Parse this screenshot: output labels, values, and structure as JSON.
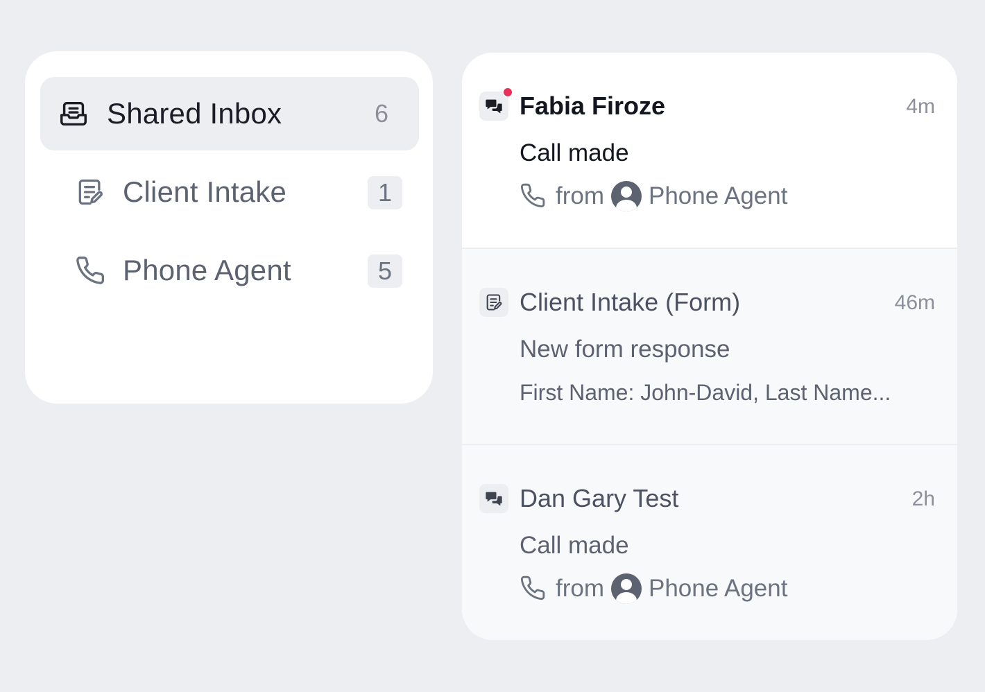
{
  "sidebar": {
    "items": [
      {
        "label": "Shared Inbox",
        "count": "6",
        "icon": "inbox-icon",
        "active": true
      },
      {
        "label": "Client Intake",
        "count": "1",
        "icon": "form-icon",
        "active": false
      },
      {
        "label": "Phone Agent",
        "count": "5",
        "icon": "phone-icon",
        "active": false
      }
    ]
  },
  "conversations": [
    {
      "title": "Fabia Firoze",
      "time": "4m",
      "subject": "Call made",
      "from_label": "from",
      "agent": "Phone Agent",
      "icon": "chat-icon",
      "unread": true
    },
    {
      "title": "Client Intake (Form)",
      "time": "46m",
      "subject": "New form response",
      "preview": "First Name: John-David, Last Name...",
      "icon": "form-icon",
      "unread": false
    },
    {
      "title": "Dan Gary Test",
      "time": "2h",
      "subject": "Call made",
      "from_label": "from",
      "agent": "Phone Agent",
      "icon": "chat-icon",
      "unread": false
    }
  ],
  "colors": {
    "background": "#edeef2",
    "unread_dot": "#e8325a",
    "text_primary": "#13161f",
    "text_muted": "#8b909b"
  }
}
